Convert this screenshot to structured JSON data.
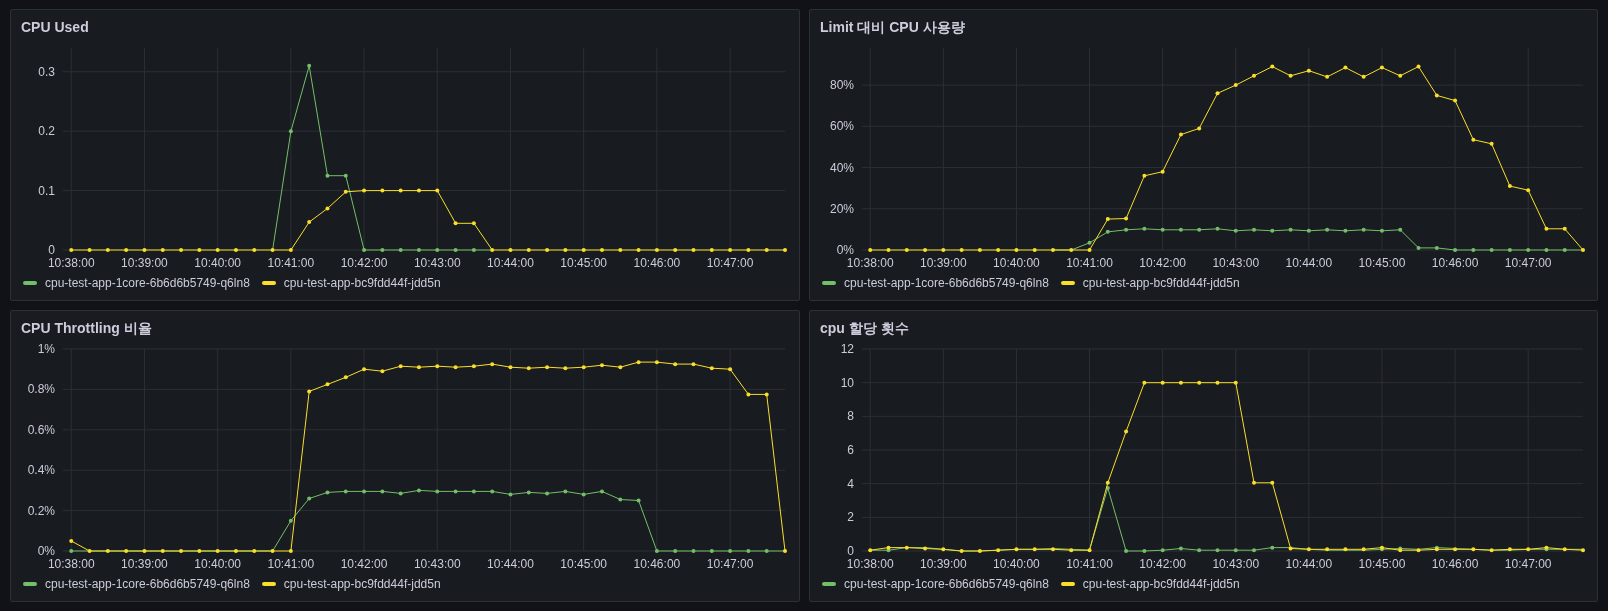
{
  "panels": [
    {
      "title": "CPU Used",
      "chart_data": {
        "type": "line",
        "categories": [
          "10:38:00",
          null,
          null,
          null,
          "10:39:00",
          null,
          null,
          null,
          "10:40:00",
          null,
          null,
          null,
          "10:41:00",
          null,
          null,
          null,
          "10:42:00",
          null,
          null,
          null,
          "10:43:00",
          null,
          null,
          null,
          "10:44:00",
          null,
          null,
          null,
          "10:45:00",
          null,
          null,
          null,
          "10:46:00",
          null,
          null,
          null,
          "10:47:00",
          null,
          null,
          null
        ],
        "ylim": [
          0,
          0.34
        ],
        "grid": true,
        "yticks": [
          {
            "value": 0,
            "label": "0"
          },
          {
            "value": 0.1,
            "label": "0.1"
          },
          {
            "value": 0.2,
            "label": "0.2"
          },
          {
            "value": 0.3,
            "label": "0.3"
          }
        ],
        "series": [
          {
            "name": "cpu-test-app-1core-6b6d6b5749-q6ln8",
            "color": "#73bf69",
            "values": [
              null,
              null,
              null,
              null,
              null,
              null,
              null,
              null,
              null,
              null,
              null,
              0,
              0.2,
              0.31,
              0.125,
              0.125,
              0,
              0,
              0,
              0,
              0,
              0,
              0,
              0,
              null,
              null,
              null,
              null,
              null,
              null,
              null,
              null,
              null,
              null,
              null,
              null,
              null,
              null,
              null,
              null
            ]
          },
          {
            "name": "cpu-test-app-bc9fdd44f-jdd5n",
            "color": "#fade2a",
            "values": [
              0,
              0,
              0,
              0,
              0,
              0,
              0,
              0,
              0,
              0,
              0,
              0,
              0,
              0.047,
              0.07,
              0.098,
              0.1,
              0.1,
              0.1,
              0.1,
              0.1,
              0.045,
              0.045,
              0,
              0,
              0,
              0,
              0,
              0,
              0,
              0,
              0,
              0,
              0,
              0,
              0,
              0,
              0,
              0,
              0
            ]
          }
        ]
      }
    },
    {
      "title": "Limit 대비 CPU 사용량",
      "chart_data": {
        "type": "line",
        "categories": [
          "10:38:00",
          null,
          null,
          null,
          "10:39:00",
          null,
          null,
          null,
          "10:40:00",
          null,
          null,
          null,
          "10:41:00",
          null,
          null,
          null,
          "10:42:00",
          null,
          null,
          null,
          "10:43:00",
          null,
          null,
          null,
          "10:44:00",
          null,
          null,
          null,
          "10:45:00",
          null,
          null,
          null,
          "10:46:00",
          null,
          null,
          null,
          "10:47:00",
          null,
          null,
          null
        ],
        "ylim": [
          0,
          98
        ],
        "grid": true,
        "yticks": [
          {
            "value": 0,
            "label": "0%"
          },
          {
            "value": 20,
            "label": "20%"
          },
          {
            "value": 40,
            "label": "40%"
          },
          {
            "value": 60,
            "label": "60%"
          },
          {
            "value": 80,
            "label": "80%"
          }
        ],
        "series": [
          {
            "name": "cpu-test-app-1core-6b6d6b5749-q6ln8",
            "color": "#73bf69",
            "values": [
              null,
              null,
              null,
              null,
              null,
              null,
              null,
              null,
              null,
              null,
              0,
              0,
              3.5,
              8.8,
              9.8,
              10.3,
              9.8,
              9.8,
              9.8,
              10.3,
              9.3,
              9.8,
              9.3,
              9.8,
              9.3,
              9.8,
              9.3,
              9.8,
              9.3,
              9.8,
              1,
              1,
              0,
              0,
              0,
              0,
              0,
              0,
              0,
              0
            ]
          },
          {
            "name": "cpu-test-app-bc9fdd44f-jdd5n",
            "color": "#fade2a",
            "values": [
              0,
              0,
              0,
              0,
              0,
              0,
              0,
              0,
              0,
              0,
              0,
              0,
              0,
              15,
              15.3,
              36,
              38,
              56,
              59,
              76,
              80,
              84.5,
              89,
              84.5,
              87,
              84,
              88.5,
              84,
              88.5,
              84.5,
              89,
              75,
              72.5,
              53.5,
              51.5,
              31,
              29,
              10.3,
              10.3,
              0
            ]
          }
        ]
      }
    },
    {
      "title": "CPU Throttling 비율",
      "chart_data": {
        "type": "line",
        "categories": [
          "10:38:00",
          null,
          null,
          null,
          "10:39:00",
          null,
          null,
          null,
          "10:40:00",
          null,
          null,
          null,
          "10:41:00",
          null,
          null,
          null,
          "10:42:00",
          null,
          null,
          null,
          "10:43:00",
          null,
          null,
          null,
          "10:44:00",
          null,
          null,
          null,
          "10:45:00",
          null,
          null,
          null,
          "10:46:00",
          null,
          null,
          null,
          "10:47:00",
          null,
          null,
          null
        ],
        "ylim": [
          0,
          1
        ],
        "grid": true,
        "yticks": [
          {
            "value": 0,
            "label": "0%"
          },
          {
            "value": 0.2,
            "label": "0.2%"
          },
          {
            "value": 0.4,
            "label": "0.4%"
          },
          {
            "value": 0.6,
            "label": "0.6%"
          },
          {
            "value": 0.8,
            "label": "0.8%"
          },
          {
            "value": 1,
            "label": "1%"
          }
        ],
        "series": [
          {
            "name": "cpu-test-app-1core-6b6d6b5749-q6ln8",
            "color": "#73bf69",
            "values": [
              0,
              0,
              0,
              0,
              0,
              0,
              0,
              0,
              0,
              0,
              0,
              0,
              0.15,
              0.26,
              0.29,
              0.295,
              0.295,
              0.295,
              0.285,
              0.3,
              0.295,
              0.295,
              0.295,
              0.295,
              0.28,
              0.29,
              0.285,
              0.295,
              0.28,
              0.295,
              0.255,
              0.25,
              0,
              0,
              0,
              0,
              0,
              0,
              0,
              0
            ]
          },
          {
            "name": "cpu-test-app-bc9fdd44f-jdd5n",
            "color": "#fade2a",
            "values": [
              0.05,
              0,
              0,
              0,
              0,
              0,
              0,
              0,
              0,
              0,
              0,
              0,
              0,
              0.79,
              0.825,
              0.86,
              0.9,
              0.89,
              0.915,
              0.91,
              0.915,
              0.91,
              0.915,
              0.925,
              0.91,
              0.905,
              0.91,
              0.905,
              0.91,
              0.92,
              0.91,
              0.935,
              0.935,
              0.925,
              0.925,
              0.905,
              0.9,
              0.775,
              0.775,
              0
            ]
          }
        ]
      }
    },
    {
      "title": "cpu 할당 횟수",
      "chart_data": {
        "type": "line",
        "categories": [
          "10:38:00",
          null,
          null,
          null,
          "10:39:00",
          null,
          null,
          null,
          "10:40:00",
          null,
          null,
          null,
          "10:41:00",
          null,
          null,
          null,
          "10:42:00",
          null,
          null,
          null,
          "10:43:00",
          null,
          null,
          null,
          "10:44:00",
          null,
          null,
          null,
          "10:45:00",
          null,
          null,
          null,
          "10:46:00",
          null,
          null,
          null,
          "10:47:00",
          null,
          null,
          null
        ],
        "ylim": [
          0,
          12
        ],
        "grid": true,
        "yticks": [
          {
            "value": 0,
            "label": "0"
          },
          {
            "value": 2,
            "label": "2"
          },
          {
            "value": 4,
            "label": "4"
          },
          {
            "value": 6,
            "label": "6"
          },
          {
            "value": 8,
            "label": "8"
          },
          {
            "value": 10,
            "label": "10"
          },
          {
            "value": 12,
            "label": "12"
          }
        ],
        "series": [
          {
            "name": "cpu-test-app-1core-6b6d6b5749-q6ln8",
            "color": "#73bf69",
            "values": [
              0.05,
              0.05,
              0.2,
              0.2,
              0.1,
              0,
              0,
              0.05,
              0.1,
              0.1,
              0.15,
              0.1,
              0.05,
              3.75,
              0,
              0,
              0.05,
              0.15,
              0.05,
              0.05,
              0.05,
              0.05,
              0.2,
              0.2,
              0.1,
              0.05,
              0.05,
              0.05,
              0.1,
              0.15,
              0.1,
              0.2,
              0.15,
              0.1,
              0.05,
              0.05,
              0.1,
              0.1,
              0.1,
              0.1
            ]
          },
          {
            "name": "cpu-test-app-bc9fdd44f-jdd5n",
            "color": "#fade2a",
            "values": [
              0.05,
              0.2,
              0.2,
              0.15,
              0.1,
              0,
              0,
              0.05,
              0.1,
              0.1,
              0.1,
              0.05,
              0.05,
              4.05,
              7.1,
              10,
              10,
              10,
              10,
              10,
              10,
              4.05,
              4.05,
              0.15,
              0.1,
              0.1,
              0.1,
              0.1,
              0.2,
              0.05,
              0.05,
              0.1,
              0.1,
              0.1,
              0.05,
              0.1,
              0.1,
              0.2,
              0.1,
              0.05
            ]
          }
        ]
      }
    }
  ]
}
